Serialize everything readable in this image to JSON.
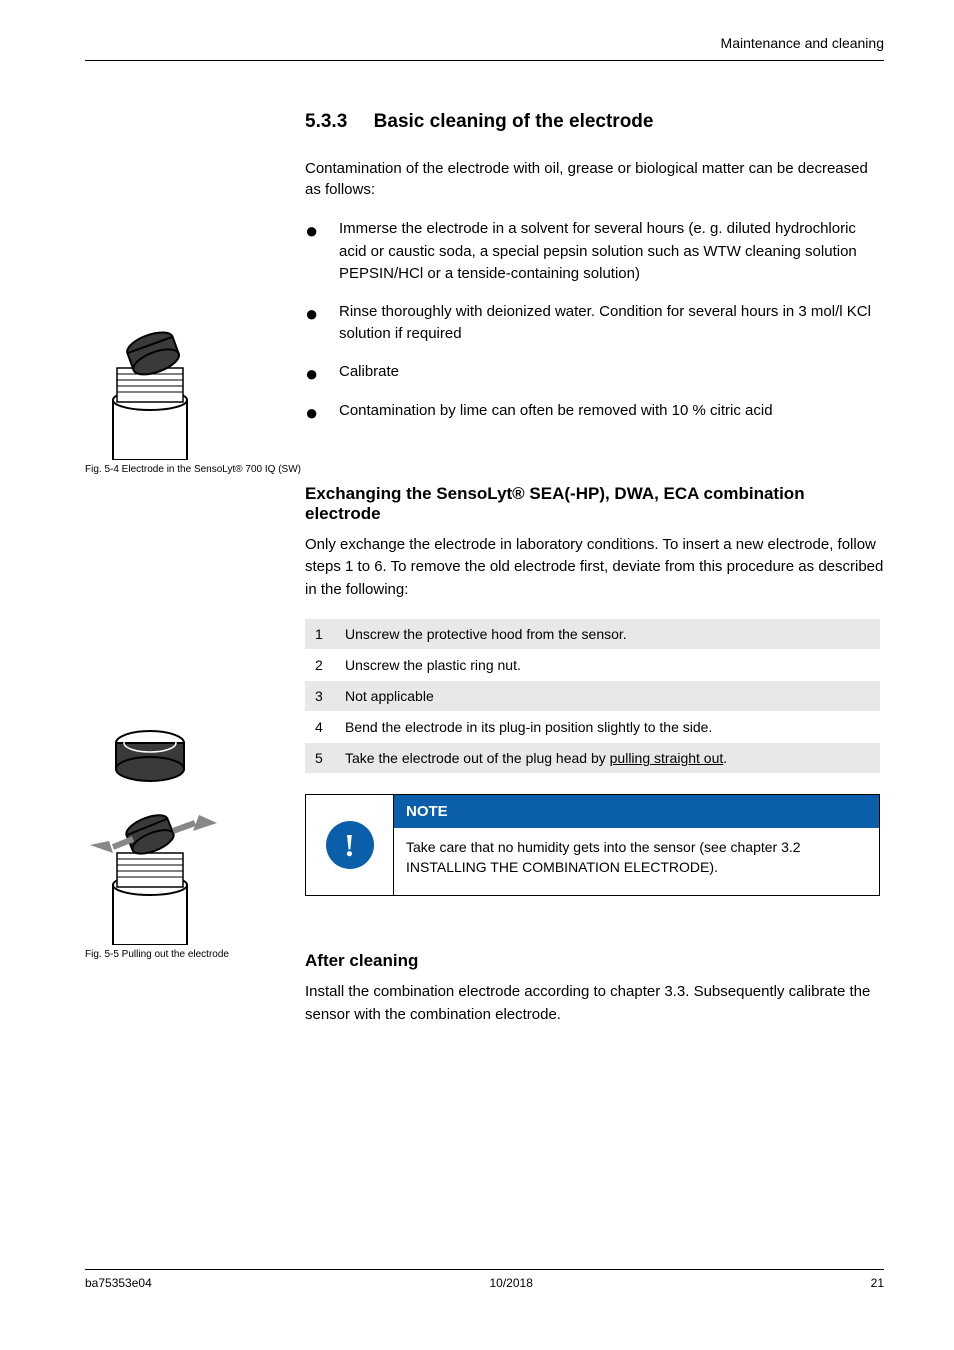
{
  "header": {
    "right": "Maintenance and cleaning"
  },
  "section": {
    "number": "5.3.3",
    "title": "Basic cleaning of the electrode",
    "intro": "Contamination of the electrode with oil, grease or biological matter can be decreased as follows:",
    "bullets": [
      "Immerse the electrode in a solvent for several hours (e. g. diluted hydrochloric acid or caustic soda, a special pepsin solution such as WTW cleaning solution PEPSIN/HCl or a tenside-containing solution)",
      "Rinse thoroughly with deionized water. Condition for several hours in 3 mol/l KCl solution if required",
      "Calibrate",
      "Contamination by lime can often be removed with 10 % citric acid"
    ]
  },
  "figure1": {
    "caption": "Fig. 5-4  Electrode in the SensoLyt® 700 IQ (SW)"
  },
  "subsection": {
    "title": "Exchanging the SensoLyt® SEA(-HP), DWA, ECA combination electrode",
    "body1": "Only exchange the electrode in laboratory conditions. To insert a new electrode, follow steps 1 to 6. To remove the old electrode first, deviate from this procedure as described in the following:",
    "steps": [
      "Unscrew the protective hood from the sensor.",
      "Unscrew the plastic ring nut.",
      "Not applicable",
      "Bend the electrode in its plug-in position slightly to the side.",
      {
        "prefix": "Take the electrode out of the plug head by ",
        "underlined": "pulling straight out",
        "suffix": "."
      }
    ]
  },
  "figure2": {
    "caption": "Fig. 5-5  Pulling out the electrode"
  },
  "note": {
    "header": "NOTE",
    "body": "Take care that no humidity gets into the sensor (see chapter 3.2 INSTALLING THE COMBINATION ELECTRODE)."
  },
  "after": {
    "title": "After cleaning",
    "body": "Install the combination electrode according to chapter 3.3. Subsequently calibrate the sensor with the combination electrode."
  },
  "footer": {
    "left": "ba75353e04",
    "center": "10/2018",
    "right": "21"
  }
}
